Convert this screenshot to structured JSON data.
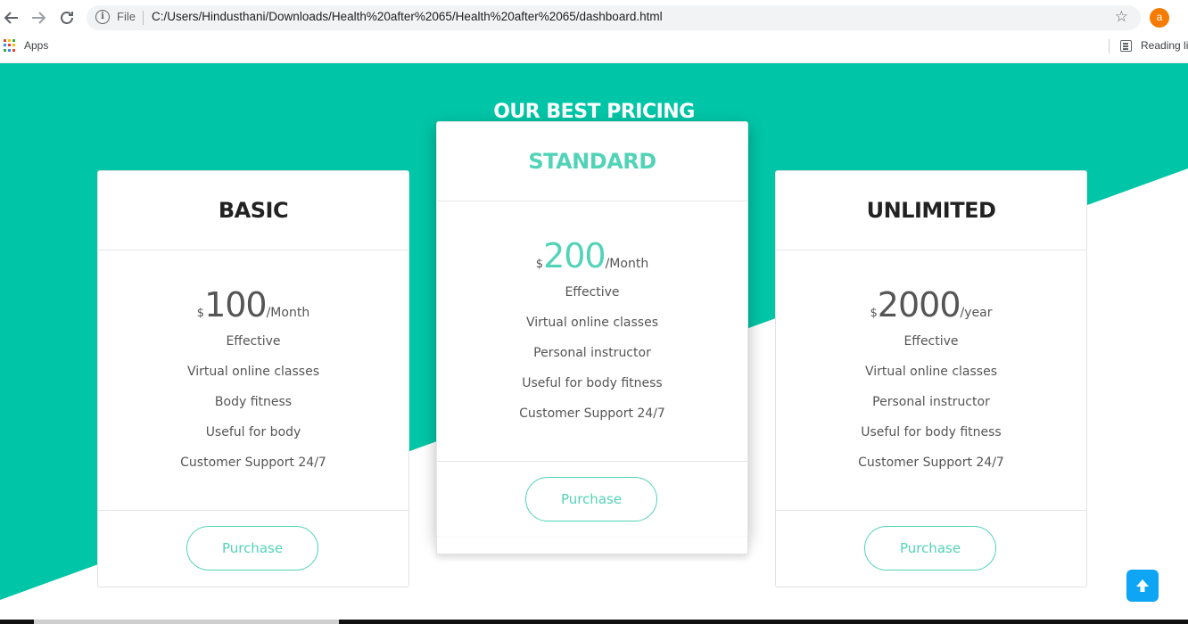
{
  "browser": {
    "url_scheme_label": "File",
    "url": "C:/Users/Hindusthani/Downloads/Health%20after%2065/Health%20after%2065/dashboard.html",
    "profile_initial": "a",
    "bookmarks": {
      "apps_label": "Apps",
      "reading_list_label": "Reading li"
    }
  },
  "colors": {
    "brand": "#00c5a6",
    "accent": "#52d3b8",
    "scroll_button": "#0ea5f4"
  },
  "icons": [
    "back-arrow-icon",
    "forward-arrow-icon",
    "reload-icon",
    "info-icon",
    "star-icon",
    "apps-grid-icon",
    "reading-list-icon",
    "arrow-up-icon"
  ],
  "pricing": {
    "title": "OUR BEST PRICING",
    "plans": [
      {
        "name": "BASIC",
        "currency": "$",
        "amount": "100",
        "period": "/Month",
        "features": [
          "Effective",
          "Virtual online classes",
          "Body fitness",
          "Useful for body",
          "Customer Support 24/7"
        ],
        "button": "Purchase"
      },
      {
        "name": "STANDARD",
        "currency": "$",
        "amount": "200",
        "period": "/Month",
        "features": [
          "Effective",
          "Virtual online classes",
          "Personal instructor",
          "Useful for body fitness",
          "Customer Support 24/7"
        ],
        "button": "Purchase"
      },
      {
        "name": "UNLIMITED",
        "currency": "$",
        "amount": "2000",
        "period": "/year",
        "features": [
          "Effective",
          "Virtual online classes",
          "Personal instructor",
          "Useful for body fitness",
          "Customer Support 24/7"
        ],
        "button": "Purchase"
      }
    ]
  }
}
